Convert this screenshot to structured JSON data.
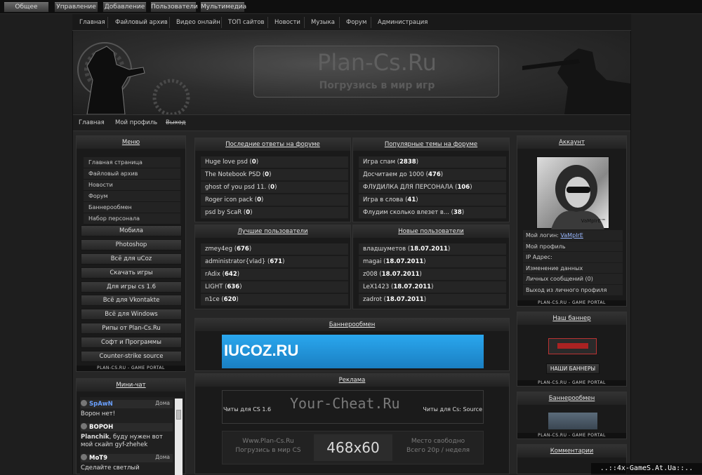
{
  "topbar": {
    "tabs": [
      "Общее",
      "Управление",
      "Добавление",
      "Пользователи",
      "Мультимедиа"
    ]
  },
  "nav": {
    "items": [
      "Главная",
      "Файловый архив",
      "Видео онлайн",
      "ТОП сайтов",
      "Новости",
      "Музыка",
      "Форум",
      "Администрация"
    ]
  },
  "header": {
    "title": "Plan-Cs.Ru",
    "subtitle": "Погрузись в мир игр"
  },
  "subnav": {
    "items": [
      "Главная",
      "Мой профиль",
      "Выход"
    ]
  },
  "menu": {
    "title": "Меню",
    "list": [
      "Главная страница",
      "Файловый архив",
      "Новости",
      "Форум",
      "Баннерообмен",
      "Набор персонала"
    ],
    "buttons": [
      "Мобила",
      "Photoshop",
      "Всё для uCoz",
      "Скачать игры",
      "Для игры cs 1.6",
      "Всё для Vkontakte",
      "Всё для Windows",
      "Рипы от Plan-Cs.Ru",
      "Софт и Программы",
      "Counter-strike source"
    ]
  },
  "brand": "PLAN-CS.RU  -  GAME PORTAL",
  "chat": {
    "title": "Мини-чат",
    "messages": [
      {
        "name": "SpAwN",
        "when": "Дома",
        "text": "Ворон нет!"
      },
      {
        "name": "ВОРОН",
        "when": "",
        "text_bold": "Planchik",
        "text": ", буду нужен вот мой скайп gyf-zhehek"
      },
      {
        "name": "MoT9",
        "when": "Дома",
        "text": "Сделайте светлый"
      }
    ]
  },
  "forum_last": {
    "title": "Последние ответы на форуме",
    "rows": [
      [
        "Huge love psd",
        "0"
      ],
      [
        "The Notebook PSD",
        "0"
      ],
      [
        "ghost of you psd 11.",
        "0"
      ],
      [
        "Roger icon pack",
        "0"
      ],
      [
        "psd by ScaR",
        "0"
      ]
    ]
  },
  "forum_popular": {
    "title": "Популярные темы на форуме",
    "rows": [
      [
        "Игра спам",
        "2838"
      ],
      [
        "Досчитаем до 1000",
        "476"
      ],
      [
        "ФЛУДИЛКА ДЛЯ ПЕРСОНАЛА",
        "106"
      ],
      [
        "Игра в слова",
        "41"
      ],
      [
        "Флудим сколько влезет в...",
        "38"
      ]
    ]
  },
  "best_users": {
    "title": "Лучшие пользователи",
    "rows": [
      [
        "zmey4eg",
        "676"
      ],
      [
        "administrator{vlad}",
        "671"
      ],
      [
        "rAdix",
        "642"
      ],
      [
        "LIGHT",
        "636"
      ],
      [
        "n1ce",
        "620"
      ]
    ]
  },
  "new_users": {
    "title": "Новые пользователи",
    "rows": [
      [
        "владшуметов",
        "18.07.2011"
      ],
      [
        "magai",
        "18.07.2011"
      ],
      [
        "z008",
        "18.07.2011"
      ],
      [
        "LeX1423",
        "18.07.2011"
      ],
      [
        "zadrot",
        "18.07.2011"
      ]
    ]
  },
  "banner_exchange": {
    "title": "Баннерообмен",
    "banner_text": "IUCOZ.RU"
  },
  "ads": {
    "title": "Реклама",
    "cheat_left": "Читы для CS 1.6",
    "cheat_center": "Your-Cheat.Ru",
    "cheat_right": "Читы для Cs: Source",
    "slot_left_1": "Www.Plan-Cs.Ru",
    "slot_left_2": "Погрузись в мир CS",
    "slot_size": "468x60",
    "slot_right_1": "Место свободно",
    "slot_right_2": "Всего 20р / неделя"
  },
  "account": {
    "title": "Аккаунт",
    "avatar_caption": "VaMpIrE™",
    "login_label": "Мой логин:",
    "login_value": "VaMpIrE",
    "items": [
      "Мой профиль",
      "IP Адрес:",
      "Изменение данных",
      "Личных сообщений (0)",
      "Выход из личного профиля"
    ]
  },
  "our_banner": {
    "title": "Наш баннер",
    "button": "НАШИ БАННЕРЫ"
  },
  "right_banner_exchange": {
    "title": "Баннерообмен"
  },
  "comments": {
    "title": "Комментарии"
  },
  "watermark": "..::4x-GameS.At.Ua::..",
  "colors": {
    "bg": "#1e1e1e",
    "panel": "#1a1a1a",
    "link_blue": "#6aa0ff",
    "banner_blue": "#1f8fd4"
  }
}
